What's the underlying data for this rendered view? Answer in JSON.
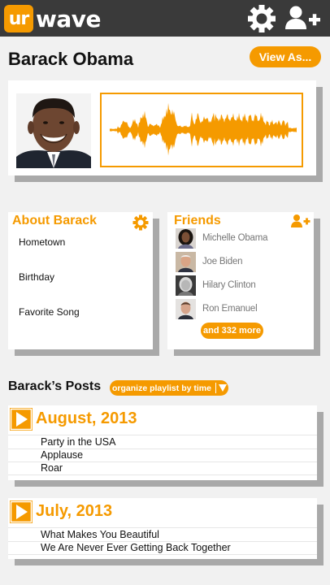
{
  "app": {
    "logo_prefix": "ur",
    "logo_word": "wave"
  },
  "accent_color": "#f59a00",
  "topbar_icons": [
    "gear-icon",
    "add-user-icon"
  ],
  "profile": {
    "name": "Barack Obama",
    "view_as_label": "View As..."
  },
  "about": {
    "title": "About Barack",
    "fields": [
      "Hometown",
      "Birthday",
      "Favorite Song"
    ]
  },
  "friends": {
    "title": "Friends",
    "list": [
      "Michelle Obama",
      "Joe Biden",
      "Hilary Clinton",
      "Ron Emanuel"
    ],
    "more_label": "and 332 more"
  },
  "posts": {
    "title": "Barack’s Posts",
    "organize_label": "organize playlist by time",
    "groups": [
      {
        "month": "August, 2013",
        "songs": [
          "Party in the USA",
          "Applause",
          "Roar"
        ]
      },
      {
        "month": "July, 2013",
        "songs": [
          "What Makes You Beautiful",
          "We Are Never Ever Getting Back Together"
        ]
      }
    ]
  }
}
